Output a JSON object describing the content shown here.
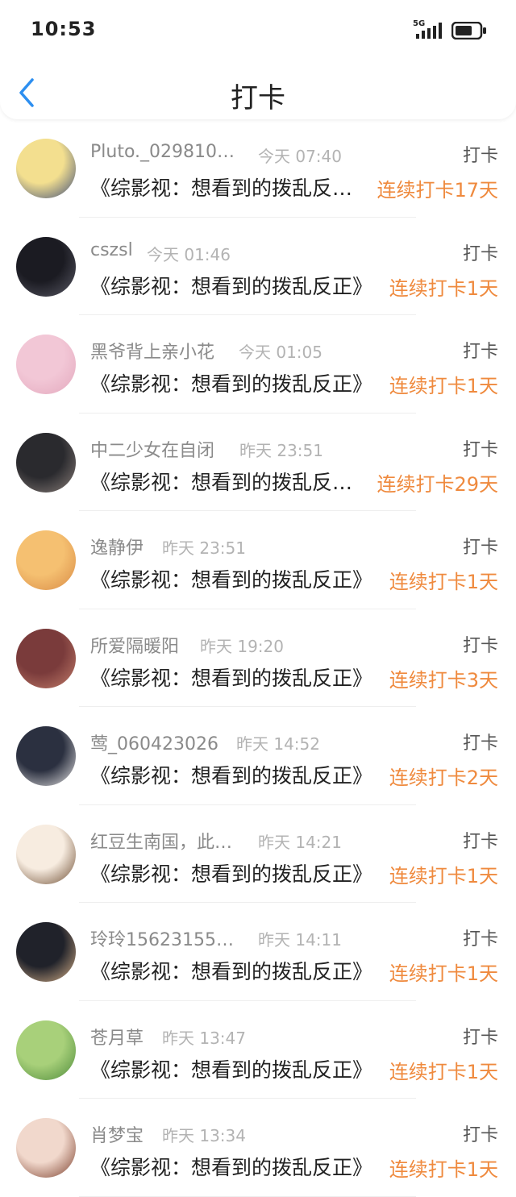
{
  "status": {
    "time": "10:53",
    "network": "5G"
  },
  "header": {
    "title": "打卡",
    "back_icon": "chevron-left-icon"
  },
  "colors": {
    "accent": "#ef8a3e",
    "back": "#2d8ff0"
  },
  "rows": [
    {
      "name": "Pluto._029810…",
      "time": "今天 07:40",
      "tag": "打卡",
      "book": "《综影视：想看到的拨乱反…",
      "streak": "连续打卡17天",
      "av1": "#f3df8f",
      "av2": "#3b4b7a"
    },
    {
      "name": "cszsl",
      "time": "今天 01:46",
      "tag": "打卡",
      "book": "《综影视：想看到的拨乱反正》",
      "streak": "连续打卡1天",
      "av1": "#1b1b22",
      "av2": "#5a5a66"
    },
    {
      "name": "黑爷背上亲小花",
      "time": "今天 01:05",
      "tag": "打卡",
      "book": "《综影视：想看到的拨乱反正》",
      "streak": "连续打卡1天",
      "av1": "#f2c7d6",
      "av2": "#e3a8bd"
    },
    {
      "name": "中二少女在自闭",
      "time": "昨天 23:51",
      "tag": "打卡",
      "book": "《综影视：想看到的拨乱反…",
      "streak": "连续打卡29天",
      "av1": "#2a2a2e",
      "av2": "#8a7f7a"
    },
    {
      "name": "逸静伊",
      "time": "昨天 23:51",
      "tag": "打卡",
      "book": "《综影视：想看到的拨乱反正》",
      "streak": "连续打卡1天",
      "av1": "#f5c071",
      "av2": "#d88a45"
    },
    {
      "name": "所爱隔暖阳",
      "time": "昨天 19:20",
      "tag": "打卡",
      "book": "《综影视：想看到的拨乱反正》",
      "streak": "连续打卡3天",
      "av1": "#7a3b3b",
      "av2": "#c47e6b"
    },
    {
      "name": "莺_060423026",
      "time": "昨天 14:52",
      "tag": "打卡",
      "book": "《综影视：想看到的拨乱反正》",
      "streak": "连续打卡2天",
      "av1": "#2b3040",
      "av2": "#e8e6e6"
    },
    {
      "name": "红豆生南国，此…",
      "time": "昨天 14:21",
      "tag": "打卡",
      "book": "《综影视：想看到的拨乱反正》",
      "streak": "连续打卡1天",
      "av1": "#f7ece0",
      "av2": "#6b4a2f"
    },
    {
      "name": "玲玲15623155…",
      "time": "昨天 14:11",
      "tag": "打卡",
      "book": "《综影视：想看到的拨乱反正》",
      "streak": "连续打卡1天",
      "av1": "#20222a",
      "av2": "#d9b28a"
    },
    {
      "name": "苍月草",
      "time": "昨天 13:47",
      "tag": "打卡",
      "book": "《综影视：想看到的拨乱反正》",
      "streak": "连续打卡1天",
      "av1": "#a8d07a",
      "av2": "#4d8a3a"
    },
    {
      "name": "肖梦宝",
      "time": "昨天 13:34",
      "tag": "打卡",
      "book": "《综影视：想看到的拨乱反正》",
      "streak": "连续打卡1天",
      "av1": "#f1d8cc",
      "av2": "#7a3d2a"
    }
  ]
}
